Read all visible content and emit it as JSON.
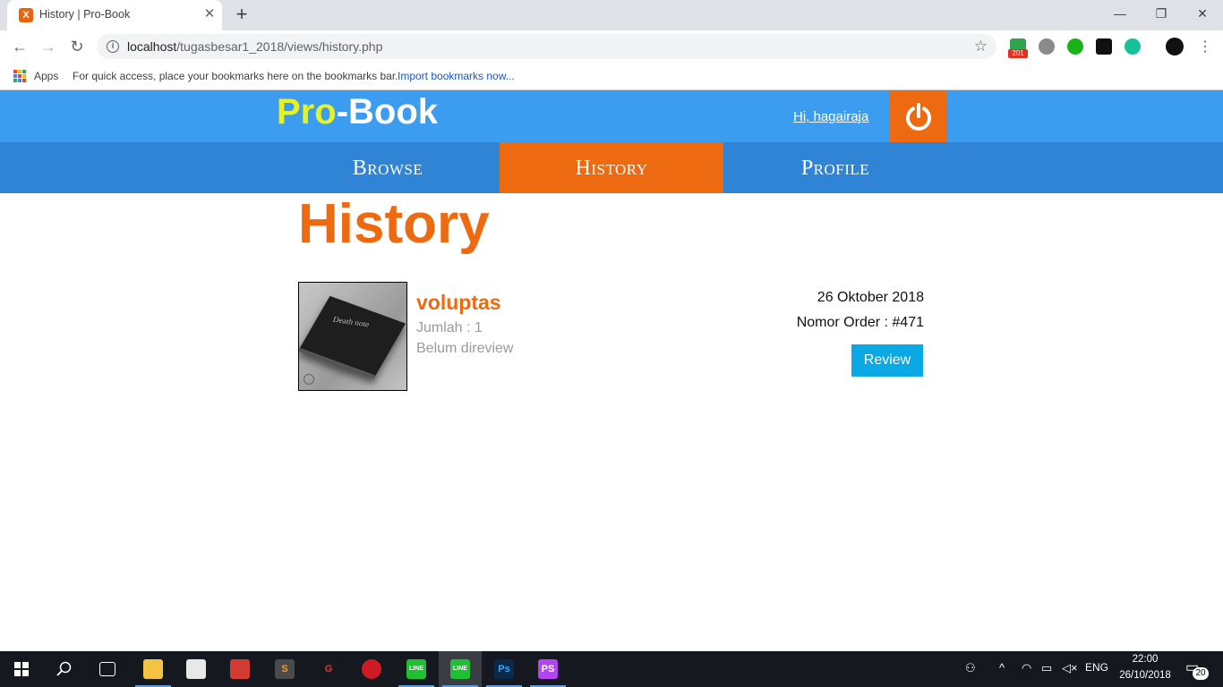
{
  "browser": {
    "tab_title": "History | Pro-Book",
    "tab_favicon": "X",
    "url_host": "localhost",
    "url_path": "/tugasbesar1_2018/views/history.php",
    "bookmarks": {
      "apps_label": "Apps",
      "hint": "For quick access, place your bookmarks here on the bookmarks bar.",
      "import_link": "Import bookmarks now..."
    },
    "extension_badge": "201"
  },
  "site": {
    "logo_pro": "Pro",
    "logo_book": "-Book",
    "greeting": "Hi, hagairaja",
    "nav": [
      {
        "label": "Browse",
        "active": false
      },
      {
        "label": "History",
        "active": true
      },
      {
        "label": "Profile",
        "active": false
      }
    ],
    "accent": "#ee6a10",
    "header_color": "#3c9df0",
    "nav_color": "#2f84d6"
  },
  "page": {
    "title": "History",
    "orders": [
      {
        "book_title": "voluptas",
        "cover_text": "Death note",
        "quantity": "Jumlah : 1",
        "review_status": "Belum direview",
        "date": "26 Oktober 2018",
        "order_number": "Nomor Order : #471",
        "action_label": "Review"
      }
    ]
  },
  "taskbar": {
    "language": "ENG",
    "time": "22:00",
    "date": "26/10/2018",
    "notifications": "20"
  }
}
